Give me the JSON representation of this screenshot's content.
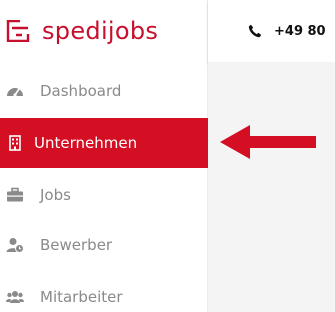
{
  "brand": {
    "name": "spedijobs",
    "accent_color": "#d40f24"
  },
  "topbar": {
    "phone_icon": "phone-icon",
    "phone_text": "+49 80"
  },
  "sidebar": {
    "items": [
      {
        "label": "Dashboard",
        "icon": "dashboard-gauge-icon",
        "active": false
      },
      {
        "label": "Unternehmen",
        "icon": "building-icon",
        "active": true
      },
      {
        "label": "Jobs",
        "icon": "briefcase-icon",
        "active": false
      },
      {
        "label": "Bewerber",
        "icon": "user-clock-icon",
        "active": false
      },
      {
        "label": "Mitarbeiter",
        "icon": "users-icon",
        "active": false
      }
    ]
  },
  "annotation": {
    "icon": "red-arrow-left-icon",
    "color": "#d40f24"
  }
}
